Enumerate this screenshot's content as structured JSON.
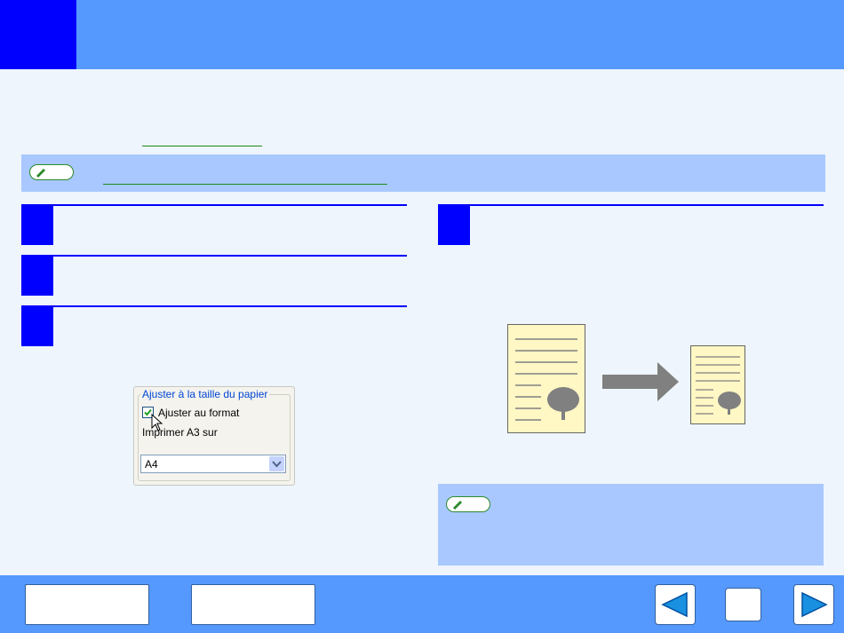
{
  "colors": {
    "header": "#5599ff",
    "chapter_box": "#0000ff",
    "background": "#eef5fc",
    "note": "#a8c8ff",
    "step": "#0000ff",
    "link": "#1a8a1a",
    "paper": "#fff7c4",
    "arrow": "#808080"
  },
  "dialog": {
    "group_title": "Ajuster à la taille du papier",
    "fit_checkbox_label": "Ajuster au format",
    "fit_checkbox_checked": true,
    "print_on_label": "Imprimer A3 sur",
    "paper_size_value": "A4"
  },
  "icons": {
    "memo": "pencil-memo-icon",
    "cursor": "mouse-pointer-icon",
    "prev": "left-triangle-icon",
    "next": "right-triangle-icon",
    "tree": "tree-icon"
  }
}
